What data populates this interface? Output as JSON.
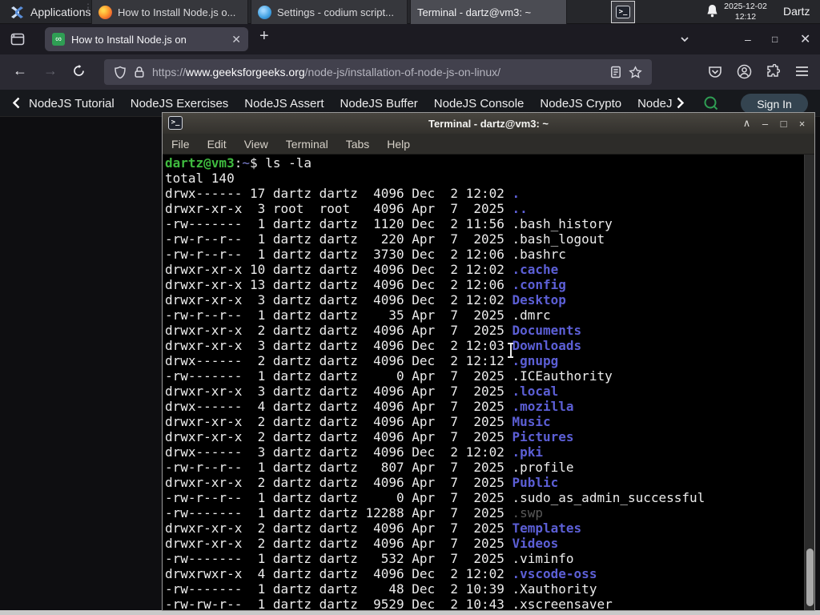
{
  "colors": {
    "prompt_green": "#3fbb3f",
    "dir_blue": "#5c5fd6",
    "cwd_blue": "#7b7fd0",
    "gfg_green": "#2f9e54"
  },
  "panel": {
    "applications_label": "Applications",
    "windows": [
      {
        "title": "How to Install Node.js o...",
        "icon": "firefox",
        "active": false
      },
      {
        "title": "Settings - codium script...",
        "icon": "codium",
        "active": false
      },
      {
        "title": "Terminal - dartz@vm3: ~",
        "icon": "terminal",
        "active": true
      }
    ],
    "clock_date": "2025-12-02",
    "clock_time": "12:12",
    "user": "Dartz"
  },
  "browser": {
    "tab_title": "How to Install Node.js on",
    "new_tab": "+",
    "url_scheme": "https://",
    "url_domain": "www.geeksforgeeks.org",
    "url_path": "/node-js/installation-of-node-js-on-linux/"
  },
  "site_nav": {
    "items": [
      "NodeJS Tutorial",
      "NodeJS Exercises",
      "NodeJS Assert",
      "NodeJS Buffer",
      "NodeJS Console",
      "NodeJS Crypto",
      "NodeJS DNS",
      "Node"
    ],
    "sign_in_label": "Sign In"
  },
  "terminal": {
    "window_title": "Terminal - dartz@vm3: ~",
    "controls": [
      "∧",
      "–",
      "□",
      "×"
    ],
    "menu": [
      "File",
      "Edit",
      "View",
      "Terminal",
      "Tabs",
      "Help"
    ],
    "prompt_user_host": "dartz@vm3",
    "prompt_sep": ":",
    "prompt_cwd": "~",
    "prompt_tail": "$ ",
    "command": "ls -la",
    "total_line": "total 140",
    "listing": [
      {
        "meta": "drwx------ 17 dartz dartz  4096 Dec  2 12:02 ",
        "name": ".",
        "t": "d"
      },
      {
        "meta": "drwxr-xr-x  3 root  root   4096 Apr  7  2025 ",
        "name": "..",
        "t": "d"
      },
      {
        "meta": "-rw-------  1 dartz dartz  1120 Dec  2 11:56 ",
        "name": ".bash_history",
        "t": "f"
      },
      {
        "meta": "-rw-r--r--  1 dartz dartz   220 Apr  7  2025 ",
        "name": ".bash_logout",
        "t": "f"
      },
      {
        "meta": "-rw-r--r--  1 dartz dartz  3730 Dec  2 12:06 ",
        "name": ".bashrc",
        "t": "f"
      },
      {
        "meta": "drwxr-xr-x 10 dartz dartz  4096 Dec  2 12:02 ",
        "name": ".cache",
        "t": "d"
      },
      {
        "meta": "drwxr-xr-x 13 dartz dartz  4096 Dec  2 12:06 ",
        "name": ".config",
        "t": "d"
      },
      {
        "meta": "drwxr-xr-x  3 dartz dartz  4096 Dec  2 12:02 ",
        "name": "Desktop",
        "t": "d"
      },
      {
        "meta": "-rw-r--r--  1 dartz dartz    35 Apr  7  2025 ",
        "name": ".dmrc",
        "t": "f"
      },
      {
        "meta": "drwxr-xr-x  2 dartz dartz  4096 Apr  7  2025 ",
        "name": "Documents",
        "t": "d"
      },
      {
        "meta": "drwxr-xr-x  3 dartz dartz  4096 Dec  2 12:03 ",
        "name": "Downloads",
        "t": "d"
      },
      {
        "meta": "drwx------  2 dartz dartz  4096 Dec  2 12:12 ",
        "name": ".gnupg",
        "t": "d"
      },
      {
        "meta": "-rw-------  1 dartz dartz     0 Apr  7  2025 ",
        "name": ".ICEauthority",
        "t": "f"
      },
      {
        "meta": "drwxr-xr-x  3 dartz dartz  4096 Apr  7  2025 ",
        "name": ".local",
        "t": "d"
      },
      {
        "meta": "drwx------  4 dartz dartz  4096 Apr  7  2025 ",
        "name": ".mozilla",
        "t": "d"
      },
      {
        "meta": "drwxr-xr-x  2 dartz dartz  4096 Apr  7  2025 ",
        "name": "Music",
        "t": "d"
      },
      {
        "meta": "drwxr-xr-x  2 dartz dartz  4096 Apr  7  2025 ",
        "name": "Pictures",
        "t": "d"
      },
      {
        "meta": "drwx------  3 dartz dartz  4096 Dec  2 12:02 ",
        "name": ".pki",
        "t": "d"
      },
      {
        "meta": "-rw-r--r--  1 dartz dartz   807 Apr  7  2025 ",
        "name": ".profile",
        "t": "f"
      },
      {
        "meta": "drwxr-xr-x  2 dartz dartz  4096 Apr  7  2025 ",
        "name": "Public",
        "t": "d"
      },
      {
        "meta": "-rw-r--r--  1 dartz dartz     0 Apr  7  2025 ",
        "name": ".sudo_as_admin_successful",
        "t": "f"
      },
      {
        "meta": "-rw-------  1 dartz dartz 12288 Apr  7  2025 ",
        "name": ".swp",
        "t": "x"
      },
      {
        "meta": "drwxr-xr-x  2 dartz dartz  4096 Apr  7  2025 ",
        "name": "Templates",
        "t": "d"
      },
      {
        "meta": "drwxr-xr-x  2 dartz dartz  4096 Apr  7  2025 ",
        "name": "Videos",
        "t": "d"
      },
      {
        "meta": "-rw-------  1 dartz dartz   532 Apr  7  2025 ",
        "name": ".viminfo",
        "t": "f"
      },
      {
        "meta": "drwxrwxr-x  4 dartz dartz  4096 Dec  2 12:02 ",
        "name": ".vscode-oss",
        "t": "d"
      },
      {
        "meta": "-rw-------  1 dartz dartz    48 Dec  2 10:39 ",
        "name": ".Xauthority",
        "t": "f"
      },
      {
        "meta": "-rw-rw-r--  1 dartz dartz  9529 Dec  2 10:43 ",
        "name": ".xscreensaver",
        "t": "f"
      }
    ]
  }
}
